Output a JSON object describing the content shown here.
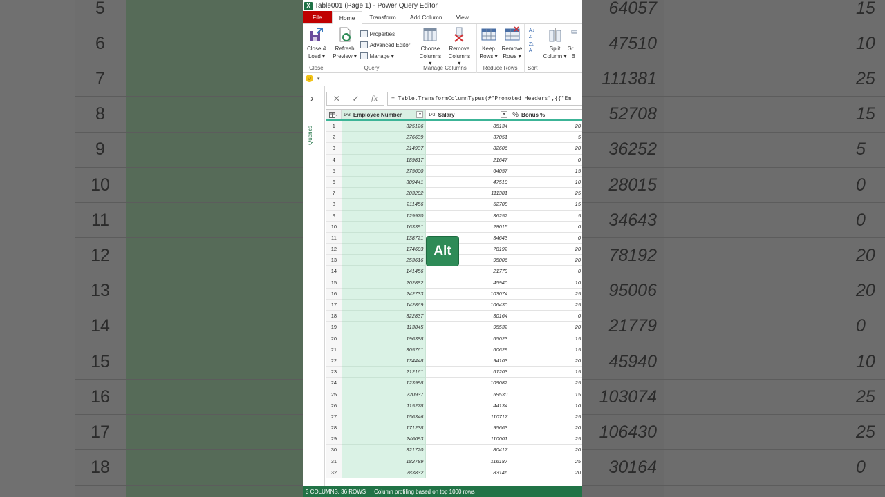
{
  "window": {
    "title": "Table001 (Page 1) - Power Query Editor",
    "app_icon": "X"
  },
  "tabs": [
    {
      "label": "File"
    },
    {
      "label": "Home"
    },
    {
      "label": "Transform"
    },
    {
      "label": "Add Column"
    },
    {
      "label": "View"
    }
  ],
  "ribbon": {
    "close_group": {
      "label": "Close",
      "close_load_1": "Close &",
      "close_load_2": "Load ▾"
    },
    "query_group": {
      "label": "Query",
      "refresh_1": "Refresh",
      "refresh_2": "Preview ▾",
      "properties": "Properties",
      "advanced_editor": "Advanced Editor",
      "manage": "Manage ▾"
    },
    "manage_columns_group": {
      "label": "Manage Columns",
      "choose_1": "Choose",
      "choose_2": "Columns ▾",
      "remove_1": "Remove",
      "remove_2": "Columns ▾"
    },
    "reduce_rows_group": {
      "label": "Reduce Rows",
      "keep_1": "Keep",
      "keep_2": "Rows ▾",
      "remove_1": "Remove",
      "remove_2": "Rows ▾"
    },
    "sort_group": {
      "label": "Sort"
    },
    "split_group": {
      "split_1": "Split",
      "split_2": "Column ▾",
      "group_1": "Gr",
      "group_2": "B"
    }
  },
  "queries_label": "Queries",
  "formula": "= Table.TransformColumnTypes(#\"Promoted Headers\",{{\"Em",
  "columns": [
    {
      "type": "1²3",
      "name": "Employee Number"
    },
    {
      "type": "1²3",
      "name": "Salary"
    },
    {
      "type": "%",
      "name": "Bonus %"
    }
  ],
  "rows": [
    [
      "1",
      "325126",
      "85134",
      "20"
    ],
    [
      "2",
      "276639",
      "37051",
      "5"
    ],
    [
      "3",
      "214937",
      "82606",
      "20"
    ],
    [
      "4",
      "189817",
      "21647",
      "0"
    ],
    [
      "5",
      "275600",
      "64057",
      "15"
    ],
    [
      "6",
      "309441",
      "47510",
      "10"
    ],
    [
      "7",
      "203202",
      "111381",
      "25"
    ],
    [
      "8",
      "211456",
      "52708",
      "15"
    ],
    [
      "9",
      "129970",
      "36252",
      "5"
    ],
    [
      "10",
      "163391",
      "28015",
      "0"
    ],
    [
      "11",
      "138721",
      "34643",
      "0"
    ],
    [
      "12",
      "174603",
      "78192",
      "20"
    ],
    [
      "13",
      "253616",
      "95006",
      "20"
    ],
    [
      "14",
      "141456",
      "21779",
      "0"
    ],
    [
      "15",
      "202882",
      "45940",
      "10"
    ],
    [
      "16",
      "242733",
      "103074",
      "25"
    ],
    [
      "17",
      "142869",
      "106430",
      "25"
    ],
    [
      "18",
      "322837",
      "30164",
      "0"
    ],
    [
      "19",
      "113845",
      "95532",
      "20"
    ],
    [
      "20",
      "196388",
      "65023",
      "15"
    ],
    [
      "21",
      "305761",
      "60629",
      "15"
    ],
    [
      "22",
      "134448",
      "94103",
      "20"
    ],
    [
      "23",
      "212161",
      "61203",
      "15"
    ],
    [
      "24",
      "123998",
      "109082",
      "25"
    ],
    [
      "25",
      "220937",
      "59530",
      "15"
    ],
    [
      "26",
      "115278",
      "44134",
      "10"
    ],
    [
      "27",
      "156346",
      "110717",
      "25"
    ],
    [
      "28",
      "171238",
      "95663",
      "20"
    ],
    [
      "29",
      "246093",
      "110001",
      "25"
    ],
    [
      "30",
      "321720",
      "80417",
      "20"
    ],
    [
      "31",
      "182789",
      "116187",
      "25"
    ],
    [
      "32",
      "283832",
      "83146",
      "20"
    ]
  ],
  "status": {
    "left": "3 COLUMNS, 36 ROWS",
    "right": "Column profiling based on top 1000 rows"
  },
  "overlay": {
    "key_hint": "Alt"
  },
  "background": {
    "left_rows": [
      "5",
      "6",
      "7",
      "8",
      "9",
      "10",
      "11",
      "12",
      "13",
      "14",
      "15",
      "16",
      "17",
      "18"
    ],
    "right_rows": [
      [
        "64057",
        "15"
      ],
      [
        "47510",
        "10"
      ],
      [
        "111381",
        "25"
      ],
      [
        "52708",
        "15"
      ],
      [
        "36252",
        "5"
      ],
      [
        "28015",
        "0"
      ],
      [
        "34643",
        "0"
      ],
      [
        "78192",
        "20"
      ],
      [
        "95006",
        "20"
      ],
      [
        "21779",
        "0"
      ],
      [
        "45940",
        "10"
      ],
      [
        "103074",
        "25"
      ],
      [
        "106430",
        "25"
      ],
      [
        "30164",
        "0"
      ]
    ]
  },
  "colors": {
    "excel_green": "#217346",
    "file_tab_red": "#c00000",
    "accent_teal": "#3cb497"
  }
}
